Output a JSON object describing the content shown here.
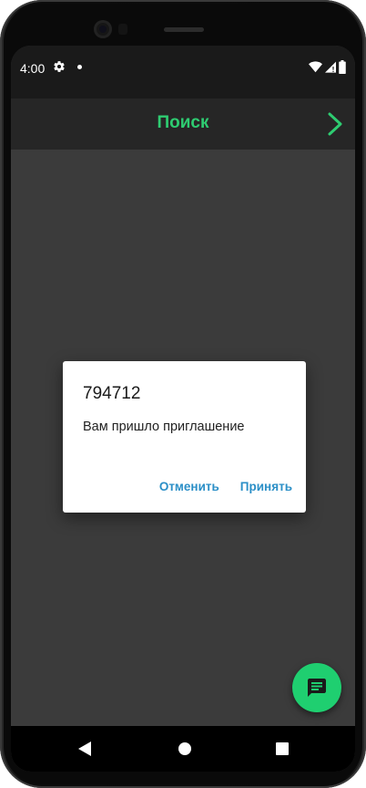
{
  "status_bar": {
    "time": "4:00",
    "icons": [
      "gear-icon",
      "notification-dot",
      "wifi-icon",
      "signal-icon",
      "battery-icon"
    ]
  },
  "app_bar": {
    "title": "Поиск",
    "forward_icon": "chevron-right-icon"
  },
  "dialog": {
    "title": "794712",
    "message": "Вам пришло приглашение",
    "cancel_label": "Отменить",
    "accept_label": "Принять"
  },
  "fab": {
    "icon": "chat-icon"
  },
  "nav_bar": {
    "icons": [
      "back-icon",
      "home-icon",
      "recents-icon"
    ]
  },
  "colors": {
    "accent_green": "#2ecc71",
    "fab_green": "#1fcf70",
    "dialog_button": "#2b8fc7",
    "background": "#3b3b3b"
  }
}
